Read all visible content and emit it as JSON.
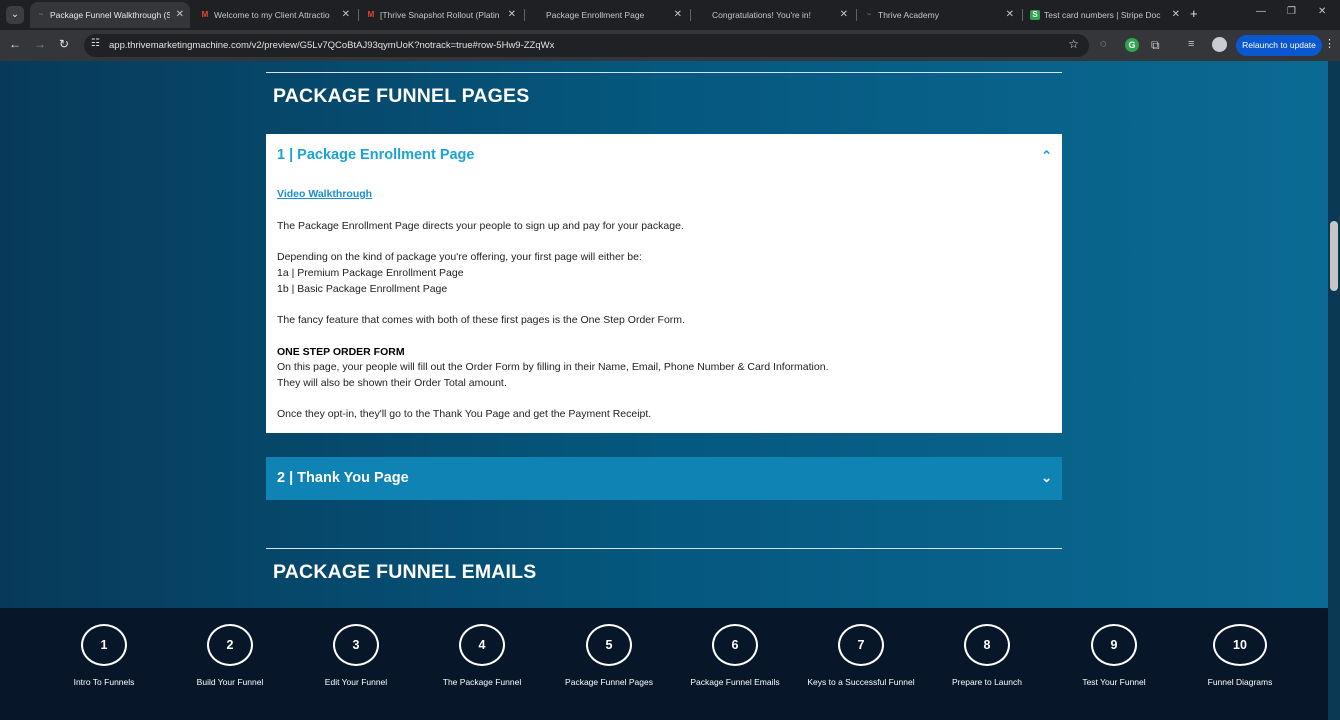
{
  "browser": {
    "tabs": [
      {
        "title": "Package Funnel Walkthrough (S",
        "icon": "thrive-icon",
        "active": true
      },
      {
        "title": "Welcome to my Client Attractio",
        "icon": "gmail-icon",
        "active": false
      },
      {
        "title": "[Thrive Snapshot Rollout (Platin",
        "icon": "gmail-icon",
        "active": false
      },
      {
        "title": "Package Enrollment Page",
        "icon": "page-icon",
        "active": false
      },
      {
        "title": "Congratulations! You're in!",
        "icon": "page-icon",
        "active": false
      },
      {
        "title": "Thrive Academy",
        "icon": "thrive-icon",
        "active": false
      },
      {
        "title": "Test card numbers | Stripe Doc",
        "icon": "stripe-icon",
        "active": false
      }
    ],
    "url": "app.thrivemarketingmachine.com/v2/preview/G5Lv7QCoBtAJ93qymUoK?notrack=true#row-5Hw9-ZZqWx",
    "relaunch_label": "Relaunch to update"
  },
  "pages_section": {
    "title": "PACKAGE FUNNEL PAGES",
    "accordions": [
      {
        "title": "1 | Package Enrollment Page",
        "expanded": true,
        "link": "Video Walkthrough",
        "p1": "The Package Enrollment Page directs your people to sign up and pay for your package.",
        "p2a": "Depending on the kind of package you're offering, your first page will either be:",
        "p2b": "1a | Premium Package Enrollment Page",
        "p2c": "1b | Basic Package Enrollment Page",
        "p3": "The fancy feature that comes with both of these first pages is the One Step Order Form.",
        "subhead": "ONE STEP ORDER FORM",
        "p4a": "On this page, your people will fill out the Order Form by filling in their Name, Email, Phone Number & Card Information.",
        "p4b": "They will also be shown their Order Total amount.",
        "p5": "Once they opt-in, they'll go to the Thank You Page and get the Payment Receipt."
      },
      {
        "title": "2 | Thank You Page",
        "expanded": false
      }
    ]
  },
  "emails_section": {
    "title": "PACKAGE FUNNEL EMAILS"
  },
  "step_nav": [
    {
      "num": "1",
      "label": "Intro To Funnels"
    },
    {
      "num": "2",
      "label": "Build Your Funnel"
    },
    {
      "num": "3",
      "label": "Edit Your Funnel"
    },
    {
      "num": "4",
      "label": "The Package Funnel"
    },
    {
      "num": "5",
      "label": "Package Funnel Pages"
    },
    {
      "num": "6",
      "label": "Package Funnel Emails"
    },
    {
      "num": "7",
      "label": "Keys to a Successful Funnel"
    },
    {
      "num": "8",
      "label": "Prepare to Launch"
    },
    {
      "num": "9",
      "label": "Test Your Funnel"
    },
    {
      "num": "10",
      "label": "Funnel Diagrams"
    }
  ],
  "colors": {
    "accent": "#1aa3d6",
    "accordion_closed": "#0f84b4",
    "page_bg": "#05587f",
    "footer_bg": "#071628"
  }
}
